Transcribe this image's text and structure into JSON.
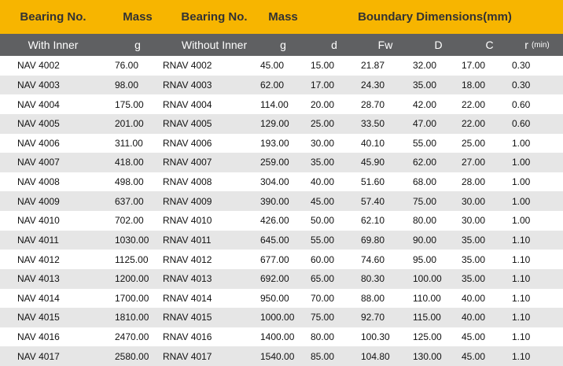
{
  "header_top": {
    "bearing_with": "Bearing No.",
    "mass_with": "Mass",
    "bearing_without": "Bearing No.",
    "mass_without": "Mass",
    "boundary": "Boundary Dimensions(mm)"
  },
  "header_sub": {
    "with_inner": "With Inner",
    "g1": "g",
    "without_inner": "Without Inner",
    "g2": "g",
    "d": "d",
    "fw": "Fw",
    "D": "D",
    "C": "C",
    "r": "r",
    "r_min": "(min)"
  },
  "rows": [
    [
      "NAV 4002",
      "76.00",
      "RNAV 4002",
      "45.00",
      "15.00",
      "21.87",
      "32.00",
      "17.00",
      "0.30"
    ],
    [
      "NAV 4003",
      "98.00",
      "RNAV 4003",
      "62.00",
      "17.00",
      "24.30",
      "35.00",
      "18.00",
      "0.30"
    ],
    [
      "NAV 4004",
      "175.00",
      "RNAV 4004",
      "114.00",
      "20.00",
      "28.70",
      "42.00",
      "22.00",
      "0.60"
    ],
    [
      "NAV 4005",
      "201.00",
      "RNAV 4005",
      "129.00",
      "25.00",
      "33.50",
      "47.00",
      "22.00",
      "0.60"
    ],
    [
      "NAV 4006",
      "311.00",
      "RNAV 4006",
      "193.00",
      "30.00",
      "40.10",
      "55.00",
      "25.00",
      "1.00"
    ],
    [
      "NAV 4007",
      "418.00",
      "RNAV 4007",
      "259.00",
      "35.00",
      "45.90",
      "62.00",
      "27.00",
      "1.00"
    ],
    [
      "NAV 4008",
      "498.00",
      "RNAV 4008",
      "304.00",
      "40.00",
      "51.60",
      "68.00",
      "28.00",
      "1.00"
    ],
    [
      "NAV 4009",
      "637.00",
      "RNAV 4009",
      "390.00",
      "45.00",
      "57.40",
      "75.00",
      "30.00",
      "1.00"
    ],
    [
      "NAV 4010",
      "702.00",
      "RNAV 4010",
      "426.00",
      "50.00",
      "62.10",
      "80.00",
      "30.00",
      "1.00"
    ],
    [
      "NAV 4011",
      "1030.00",
      "RNAV 4011",
      "645.00",
      "55.00",
      "69.80",
      "90.00",
      "35.00",
      "1.10"
    ],
    [
      "NAV 4012",
      "1125.00",
      "RNAV 4012",
      "677.00",
      "60.00",
      "74.60",
      "95.00",
      "35.00",
      "1.10"
    ],
    [
      "NAV 4013",
      "1200.00",
      "RNAV 4013",
      "692.00",
      "65.00",
      "80.30",
      "100.00",
      "35.00",
      "1.10"
    ],
    [
      "NAV 4014",
      "1700.00",
      "RNAV 4014",
      "950.00",
      "70.00",
      "88.00",
      "110.00",
      "40.00",
      "1.10"
    ],
    [
      "NAV 4015",
      "1810.00",
      "RNAV 4015",
      "1000.00",
      "75.00",
      "92.70",
      "115.00",
      "40.00",
      "1.10"
    ],
    [
      "NAV 4016",
      "2470.00",
      "RNAV 4016",
      "1400.00",
      "80.00",
      "100.30",
      "125.00",
      "45.00",
      "1.10"
    ],
    [
      "NAV 4017",
      "2580.00",
      "RNAV 4017",
      "1540.00",
      "85.00",
      "104.80",
      "130.00",
      "45.00",
      "1.10"
    ]
  ],
  "colors": {
    "header_accent": "#f7b500",
    "subheader": "#5f6062",
    "row_alt": "#e6e6e6"
  }
}
